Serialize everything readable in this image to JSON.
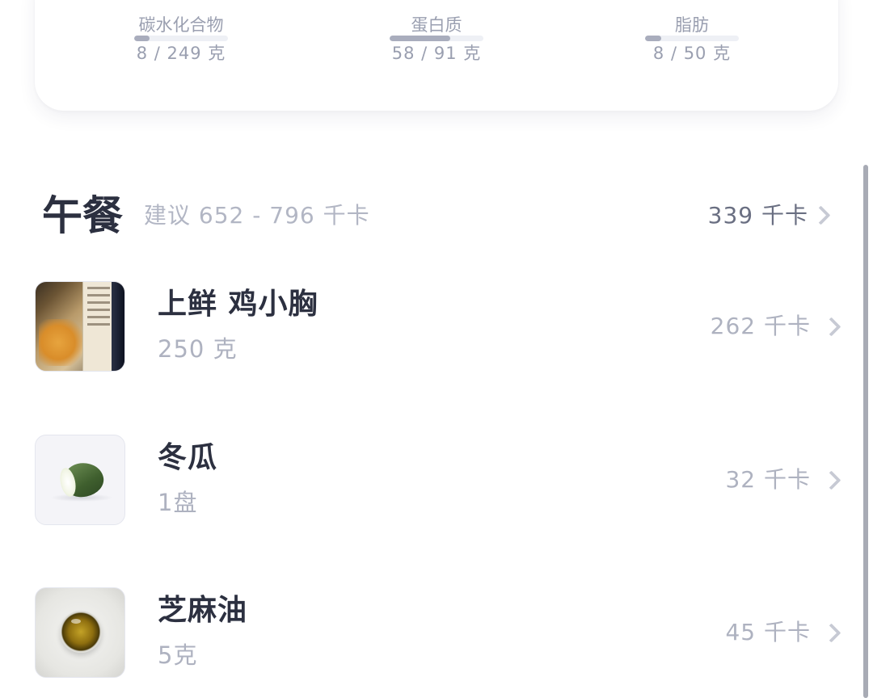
{
  "macros": [
    {
      "name": "碳水化合物",
      "value": "8 / 249 克",
      "progress": 0.16
    },
    {
      "name": "蛋白质",
      "value": "58 / 91 克",
      "progress": 0.65
    },
    {
      "name": "脂肪",
      "value": "8 / 50 克",
      "progress": 0.17
    }
  ],
  "meal": {
    "title": "午餐",
    "suggestion": "建议 652 - 796 千卡",
    "total": "339 千卡"
  },
  "foods": [
    {
      "name": "上鲜 鸡小胸",
      "amount": "250 克",
      "kcal": "262 千卡",
      "image": "chicken-breast-package"
    },
    {
      "name": "冬瓜",
      "amount": "1盘",
      "kcal": "32 千卡",
      "image": "winter-melon"
    },
    {
      "name": "芝麻油",
      "amount": "5克",
      "kcal": "45 千卡",
      "image": "sesame-oil"
    }
  ],
  "colors": {
    "title": "#2c3040",
    "muted": "#aeb2c0",
    "progress_fill": "#a9adbd",
    "progress_track": "#eef0f5"
  }
}
